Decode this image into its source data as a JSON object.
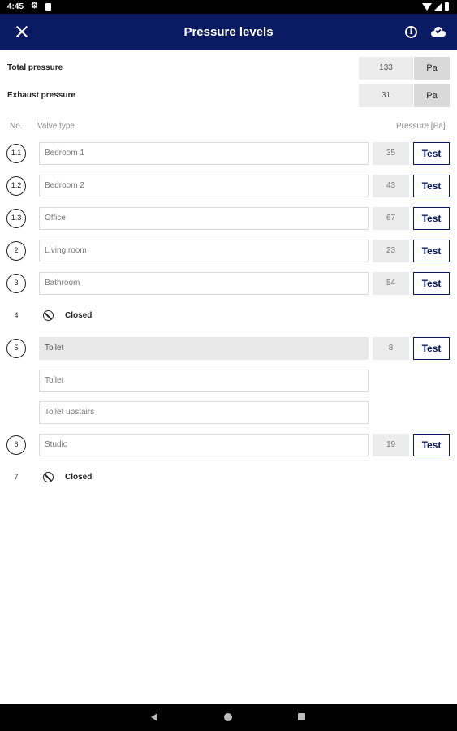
{
  "status_bar": {
    "time": "4:45"
  },
  "header": {
    "title": "Pressure levels"
  },
  "totals": [
    {
      "label": "Total pressure",
      "value": "133",
      "unit": "Pa"
    },
    {
      "label": "Exhaust pressure",
      "value": "31",
      "unit": "Pa"
    }
  ],
  "columns": {
    "no": "No.",
    "valve_type": "Valve type",
    "pressure": "Pressure [Pa]"
  },
  "valves": {
    "r1": {
      "no": "1.1",
      "name": "Bedroom 1",
      "pressure": "35",
      "button": "Test"
    },
    "r2": {
      "no": "1.2",
      "name": "Bedroom 2",
      "pressure": "43",
      "button": "Test"
    },
    "r3": {
      "no": "1.3",
      "name": "Office",
      "pressure": "67",
      "button": "Test"
    },
    "r4": {
      "no": "2",
      "name": "Living room",
      "pressure": "23",
      "button": "Test"
    },
    "r5": {
      "no": "3",
      "name": "Bathroom",
      "pressure": "54",
      "button": "Test"
    },
    "r6": {
      "no": "4",
      "status": "Closed"
    },
    "r7": {
      "no": "5",
      "name": "Toilet",
      "pressure": "8",
      "button": "Test",
      "sub_fields": [
        "Toilet",
        "Toilet upstairs"
      ]
    },
    "r8": {
      "no": "6",
      "name": "Studio",
      "pressure": "19",
      "button": "Test"
    },
    "r9": {
      "no": "7",
      "status": "Closed"
    }
  }
}
